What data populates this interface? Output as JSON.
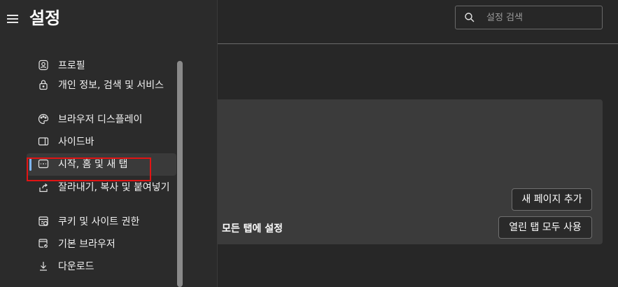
{
  "header": {
    "title": "설정"
  },
  "search": {
    "placeholder": "설정 검색"
  },
  "sidebar": {
    "items": [
      {
        "label": "프로필",
        "icon": "profile-icon"
      },
      {
        "label": "개인 정보, 검색 및 서비스",
        "icon": "lock-icon"
      },
      {
        "label": "브라우저 디스플레이",
        "icon": "palette-icon"
      },
      {
        "label": "사이드바",
        "icon": "sidebar-icon"
      },
      {
        "label": "시작, 홈 및 새 탭",
        "icon": "start-page-icon",
        "active": true
      },
      {
        "label": "잘라내기, 복사 및 붙여넣기",
        "icon": "share-icon"
      },
      {
        "label": "쿠키 및 사이트 권한",
        "icon": "cookie-icon"
      },
      {
        "label": "기본 브라우저",
        "icon": "default-browser-icon"
      },
      {
        "label": "다운로드",
        "icon": "download-icon"
      }
    ]
  },
  "main": {
    "setting_label": "모든 탭에 설정",
    "add_page_button": "새 페이지 추가",
    "use_open_tabs_button": "열린 탭 모두 사용"
  },
  "colors": {
    "accent": "#7eb6f5",
    "highlight_box": "#e11414"
  }
}
